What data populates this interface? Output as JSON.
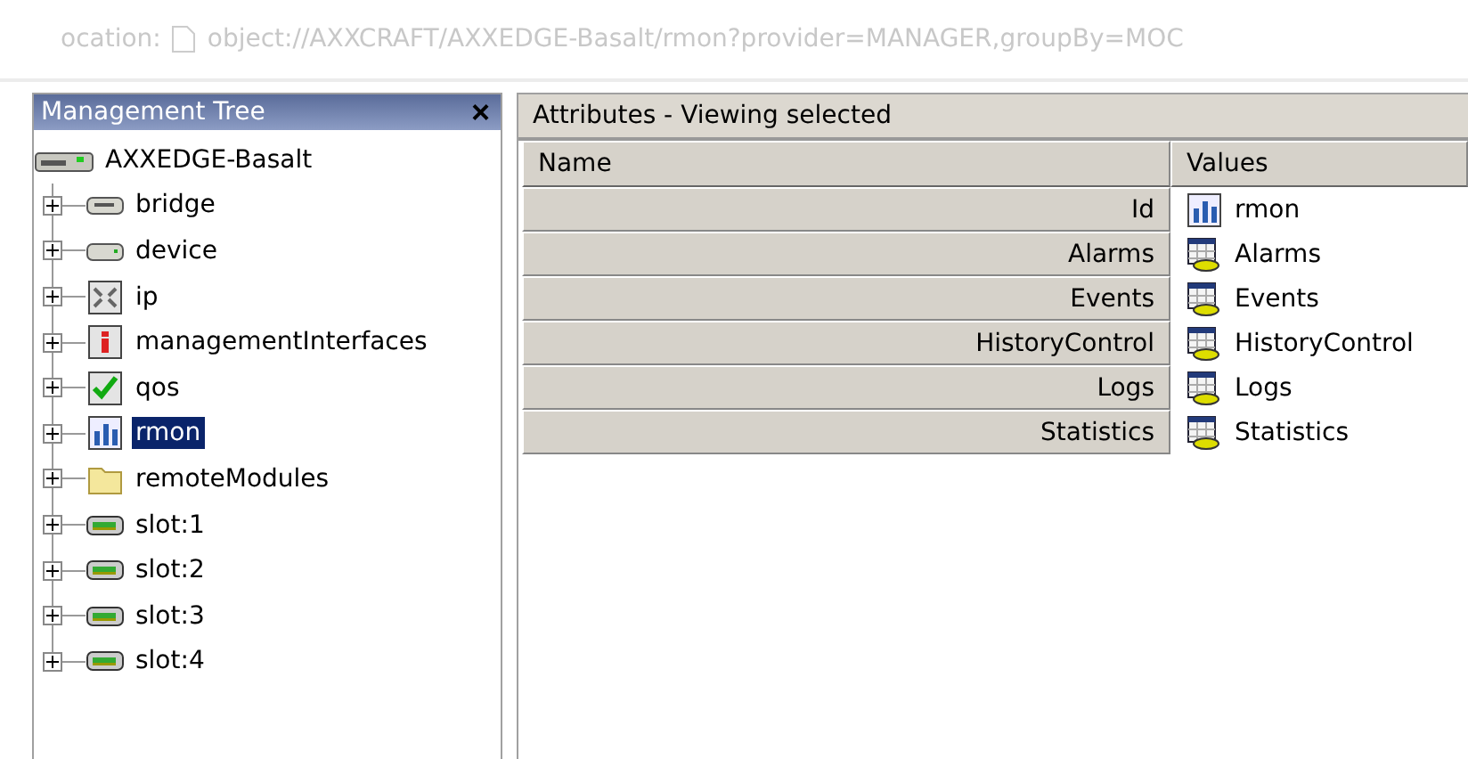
{
  "location_bar": {
    "label": "ocation:",
    "path": "object://AXXCRAFT/AXXEDGE-Basalt/rmon?provider=MANAGER,groupBy=MOC"
  },
  "tree_panel": {
    "title": "Management Tree",
    "close": "×",
    "root": {
      "label": "AXXEDGE-Basalt",
      "kind": "chassis",
      "selected": false,
      "children": [
        {
          "label": "bridge",
          "kind": "bridge",
          "expanded": false,
          "selected": false
        },
        {
          "label": "device",
          "kind": "device",
          "expanded": false,
          "selected": false
        },
        {
          "label": "ip",
          "kind": "ip",
          "expanded": false,
          "selected": false
        },
        {
          "label": "managementInterfaces",
          "kind": "info",
          "expanded": false,
          "selected": false
        },
        {
          "label": "qos",
          "kind": "check",
          "expanded": false,
          "selected": false
        },
        {
          "label": "rmon",
          "kind": "chart",
          "expanded": false,
          "selected": true
        },
        {
          "label": "remoteModules",
          "kind": "folder",
          "expanded": false,
          "selected": false
        },
        {
          "label": "slot:1",
          "kind": "slot",
          "expanded": false,
          "selected": false
        },
        {
          "label": "slot:2",
          "kind": "slot",
          "expanded": false,
          "selected": false
        },
        {
          "label": "slot:3",
          "kind": "slot",
          "expanded": false,
          "selected": false
        },
        {
          "label": "slot:4",
          "kind": "slot",
          "expanded": false,
          "selected": false
        }
      ]
    }
  },
  "attributes_panel": {
    "title": "Attributes - Viewing selected",
    "table": {
      "columns": [
        "Name",
        "Values"
      ],
      "rows": [
        {
          "name": "Id",
          "value": "rmon",
          "kind": "chart"
        },
        {
          "name": "Alarms",
          "value": "Alarms",
          "kind": "table"
        },
        {
          "name": "Events",
          "value": "Events",
          "kind": "table"
        },
        {
          "name": "HistoryControl",
          "value": "HistoryControl",
          "kind": "table"
        },
        {
          "name": "Logs",
          "value": "Logs",
          "kind": "table"
        },
        {
          "name": "Statistics",
          "value": "Statistics",
          "kind": "table"
        }
      ]
    }
  }
}
